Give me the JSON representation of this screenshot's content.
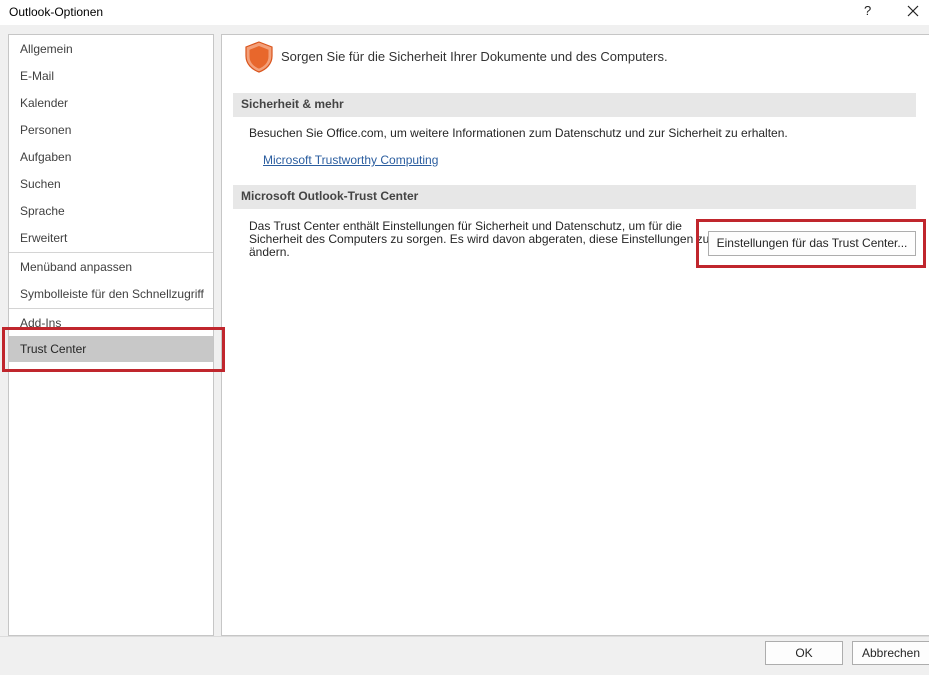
{
  "window": {
    "title": "Outlook-Optionen",
    "help_label": "?",
    "close_icon": "close-icon"
  },
  "sidebar": {
    "items": [
      {
        "label": "Allgemein"
      },
      {
        "label": "E-Mail"
      },
      {
        "label": "Kalender"
      },
      {
        "label": "Personen"
      },
      {
        "label": "Aufgaben"
      },
      {
        "label": "Suchen"
      },
      {
        "label": "Sprache"
      },
      {
        "label": "Erweitert"
      },
      {
        "label": "Menüband anpassen"
      },
      {
        "label": "Symbolleiste für den Schnellzugriff"
      },
      {
        "label": "Add-Ins"
      },
      {
        "label": "Trust Center",
        "selected": true
      }
    ]
  },
  "main": {
    "headline": "Sorgen Sie für die Sicherheit Ihrer Dokumente und des Computers.",
    "headline_icon": "shield-icon",
    "shield_color": "#e8672c",
    "section1": {
      "title": "Sicherheit & mehr",
      "text": "Besuchen Sie Office.com, um weitere Informationen zum Datenschutz und zur Sicherheit zu erhalten.",
      "link": "Microsoft Trustworthy Computing"
    },
    "section2": {
      "title": "Microsoft Outlook-Trust Center",
      "text_line1": "Das Trust Center enthält Einstellungen für Sicherheit und Datenschutz, um für die",
      "text_line2": "Sicherheit des Computers zu sorgen. Es wird davon abgeraten, diese Einstellungen zu",
      "text_line3": "ändern.",
      "button": "Einstellungen für das Trust Center..."
    }
  },
  "footer": {
    "ok": "OK",
    "cancel": "Abbrechen"
  },
  "highlight_color": "#c0262d"
}
